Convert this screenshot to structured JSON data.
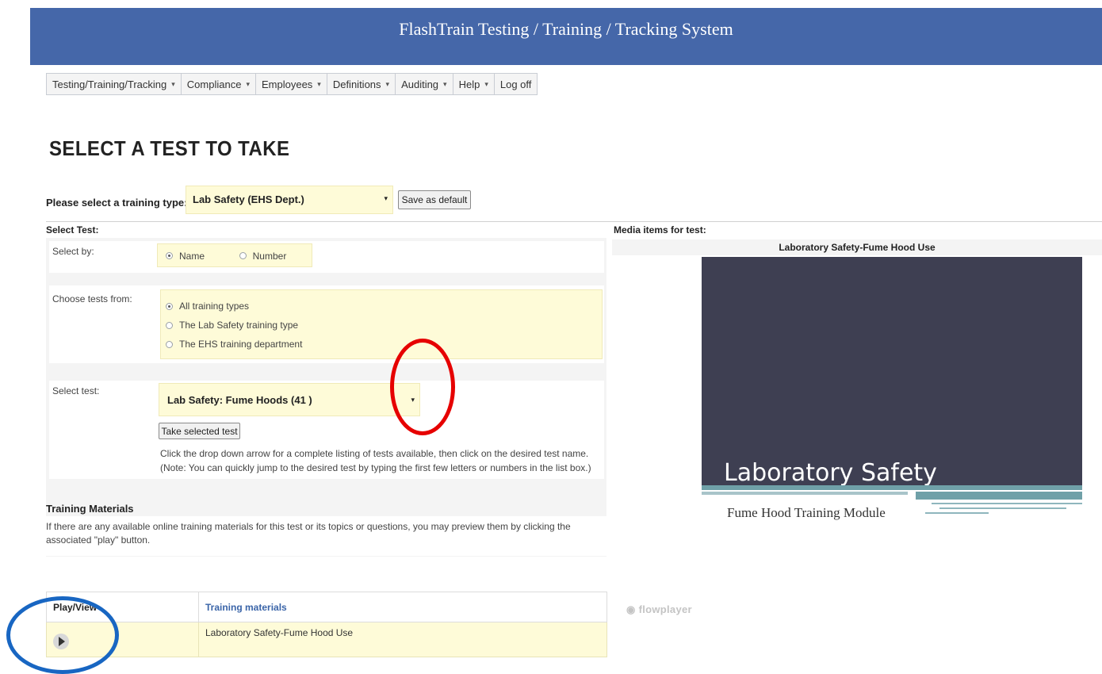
{
  "header": {
    "title": "FlashTrain Testing / Training / Tracking System"
  },
  "nav": {
    "items": [
      {
        "label": "Testing/Training/Tracking",
        "caret": "▾"
      },
      {
        "label": "Compliance",
        "caret": "▾"
      },
      {
        "label": "Employees",
        "caret": "▾"
      },
      {
        "label": "Definitions",
        "caret": "▾"
      },
      {
        "label": "Auditing",
        "caret": "▾"
      },
      {
        "label": "Help",
        "caret": "▾"
      },
      {
        "label": "Log off",
        "caret": ""
      }
    ]
  },
  "page": {
    "title": "SELECT A TEST TO TAKE",
    "training_type_label": "Please select a training type:",
    "training_type_value": "Lab Safety (EHS Dept.)",
    "save_default_label": "Save as default"
  },
  "select_test": {
    "heading": "Select Test:",
    "select_by_label": "Select by:",
    "select_by_options": [
      {
        "label": "Name",
        "checked": true
      },
      {
        "label": "Number",
        "checked": false
      }
    ],
    "choose_from_label": "Choose tests from:",
    "choose_from_options": [
      {
        "label": "All training types",
        "checked": true
      },
      {
        "label": "The Lab Safety training type",
        "checked": false
      },
      {
        "label": "The EHS training department",
        "checked": false
      }
    ],
    "select_test_label": "Select test:",
    "select_test_value": "Lab Safety: Fume Hoods (41 )",
    "take_test_label": "Take selected test",
    "help_line_1": "Click the drop down arrow for a complete listing of tests available, then click on the desired test name.",
    "help_line_2": "(Note:  You can quickly jump to the desired test by typing the first few letters or numbers in the list box.)"
  },
  "training_materials": {
    "heading": "Training Materials",
    "description": "If there are any available online training materials for this test or its topics or questions, you may preview them by clicking the associated \"play\" button.",
    "columns": [
      "Play/View",
      "Training materials"
    ],
    "rows": [
      {
        "name": "Laboratory Safety-Fume Hood Use"
      }
    ]
  },
  "media": {
    "heading": "Media items for test:",
    "item_title": "Laboratory Safety-Fume Hood Use",
    "slide_title": "Laboratory Safety",
    "slide_subtitle": "Fume Hood Training Module",
    "player_brand": "flowplayer"
  },
  "colors": {
    "banner": "#4567a9",
    "highlight": "#fefbd8",
    "annotation_red": "#e60000",
    "annotation_blue": "#1866c2",
    "slide_bg": "#3e3f52",
    "slide_accent": "#6fa0a8"
  }
}
